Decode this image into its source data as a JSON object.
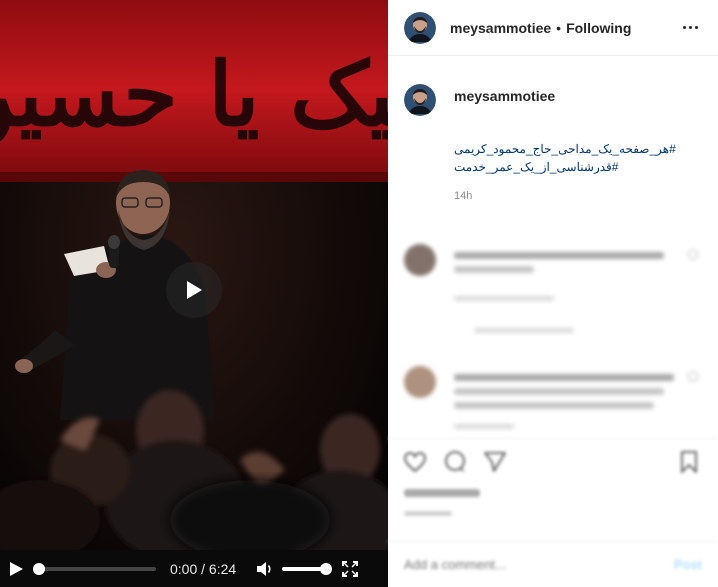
{
  "video": {
    "banner_text": "لبیک یا حسین",
    "current_time": "0:00",
    "separator": " / ",
    "duration": "6:24",
    "progress": 0.0,
    "volume": 1.0
  },
  "post": {
    "username": "meysammotiee",
    "dot": "•",
    "follow_status": "Following",
    "caption_username": "meysammotiee",
    "hashtags": [
      "#هر_صفحه_یک_مداحی_حاج_محمود_کریمی",
      "#قدرشناسی_از_یک_عمر_خدمت"
    ],
    "posted_ago": "14h"
  },
  "comment_input": {
    "placeholder": "Add a comment...",
    "post_label": "Post"
  },
  "icons": {
    "more": "more-horizontal-icon",
    "like": "heart-icon",
    "comment": "comment-bubble-icon",
    "share": "share-plane-icon",
    "save": "bookmark-icon",
    "play": "play-icon",
    "volume": "volume-icon",
    "fullscreen": "fullscreen-icon"
  },
  "colors": {
    "hashtag": "#00376b",
    "muted": "#8e8e8e",
    "banner_red": "#b5151b",
    "post_button": "#b2dffc"
  }
}
